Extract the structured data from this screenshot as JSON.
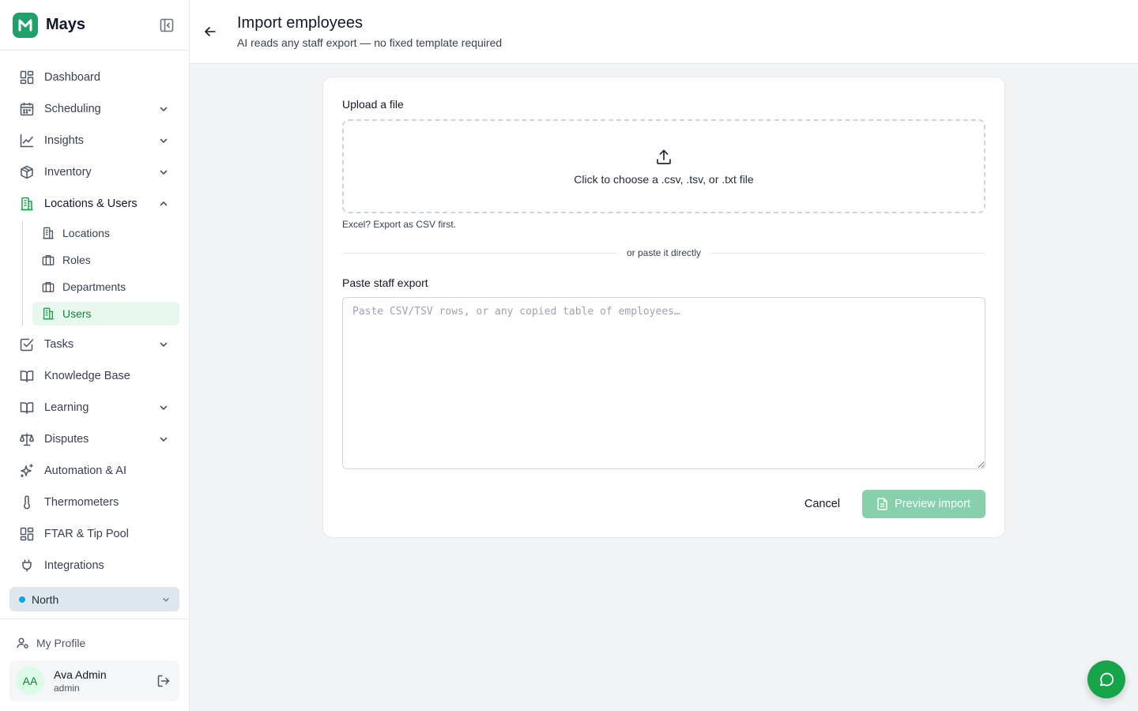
{
  "app": {
    "name": "Mays",
    "accent": "#16a34a"
  },
  "sidebar": {
    "items": [
      {
        "label": "Dashboard",
        "icon": "dashboard-icon"
      },
      {
        "label": "Scheduling",
        "icon": "calendar-icon",
        "expandable": true
      },
      {
        "label": "Insights",
        "icon": "chart-line-icon",
        "expandable": true
      },
      {
        "label": "Inventory",
        "icon": "box-icon",
        "expandable": true
      },
      {
        "label": "Locations & Users",
        "icon": "building-icon",
        "expandable": true,
        "expanded": true,
        "children": [
          {
            "label": "Locations",
            "icon": "building-icon"
          },
          {
            "label": "Roles",
            "icon": "briefcase-icon"
          },
          {
            "label": "Departments",
            "icon": "briefcase-icon"
          },
          {
            "label": "Users",
            "icon": "building-icon",
            "active": true
          }
        ]
      },
      {
        "label": "Tasks",
        "icon": "checkbox-icon",
        "expandable": true
      },
      {
        "label": "Knowledge Base",
        "icon": "book-icon"
      },
      {
        "label": "Learning",
        "icon": "book-icon",
        "expandable": true
      },
      {
        "label": "Disputes",
        "icon": "scale-icon",
        "expandable": true
      },
      {
        "label": "Automation & AI",
        "icon": "sparkles-icon"
      },
      {
        "label": "Thermometers",
        "icon": "thermometer-icon"
      },
      {
        "label": "FTAR & Tip Pool",
        "icon": "dashboard-icon"
      },
      {
        "label": "Integrations",
        "icon": "plug-icon"
      }
    ],
    "location_selector": {
      "value": "North",
      "status_color": "#0ea5e9"
    },
    "profile_link": "My Profile",
    "user": {
      "initials": "AA",
      "name": "Ava Admin",
      "role": "admin"
    }
  },
  "header": {
    "title": "Import employees",
    "subtitle": "AI reads any staff export — no fixed template required"
  },
  "form": {
    "upload_label": "Upload a file",
    "dropzone_text": "Click to choose a .csv, .tsv, or .txt file",
    "hint": "Excel? Export as CSV first.",
    "divider_text": "or paste it directly",
    "paste_label": "Paste staff export",
    "paste_placeholder": "Paste CSV/TSV rows, or any copied table of employees…",
    "paste_value": "",
    "cancel_label": "Cancel",
    "preview_label": "Preview import"
  }
}
